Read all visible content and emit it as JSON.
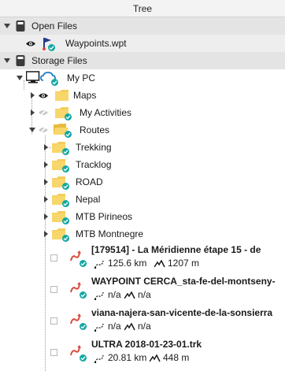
{
  "panel": {
    "title": "Tree"
  },
  "sections": {
    "open_files": "Open Files",
    "storage_files": "Storage Files"
  },
  "open_files_items": [
    {
      "name": "Waypoints.wpt",
      "icon": "waypoints-flag-icon",
      "visible": true
    }
  ],
  "storage": {
    "pc": {
      "name": "My PC",
      "icon": "computer-cloud-icon"
    },
    "folders": [
      {
        "name": "Maps",
        "visible": true
      },
      {
        "name": "My Activities",
        "visible": false
      },
      {
        "name": "Routes",
        "visible": false
      }
    ],
    "routes_children": [
      {
        "name": "Trekking"
      },
      {
        "name": "Tracklog"
      },
      {
        "name": "ROAD"
      },
      {
        "name": "Nepal"
      },
      {
        "name": "MTB Pirineos"
      },
      {
        "name": "MTB Montnegre"
      }
    ],
    "tracks": [
      {
        "name": "[179514] - La Méridienne étape 15 - de",
        "distance": "125.6 km",
        "elevation": "1207 m"
      },
      {
        "name": "WAYPOINT CERCA_sta-fe-del-montseny-",
        "distance": "n/a",
        "elevation": "n/a"
      },
      {
        "name": "viana-najera-san-vicente-de-la-sonsierra",
        "distance": "n/a",
        "elevation": "n/a"
      },
      {
        "name": "ULTRA 2018-01-23-01.trk",
        "distance": "20.81 km",
        "elevation": "448 m"
      }
    ]
  },
  "colors": {
    "status_check": "#12a7a3",
    "folder": "#f5cd5a",
    "track": "#d84a3c",
    "cloud": "#1f7fc7"
  }
}
